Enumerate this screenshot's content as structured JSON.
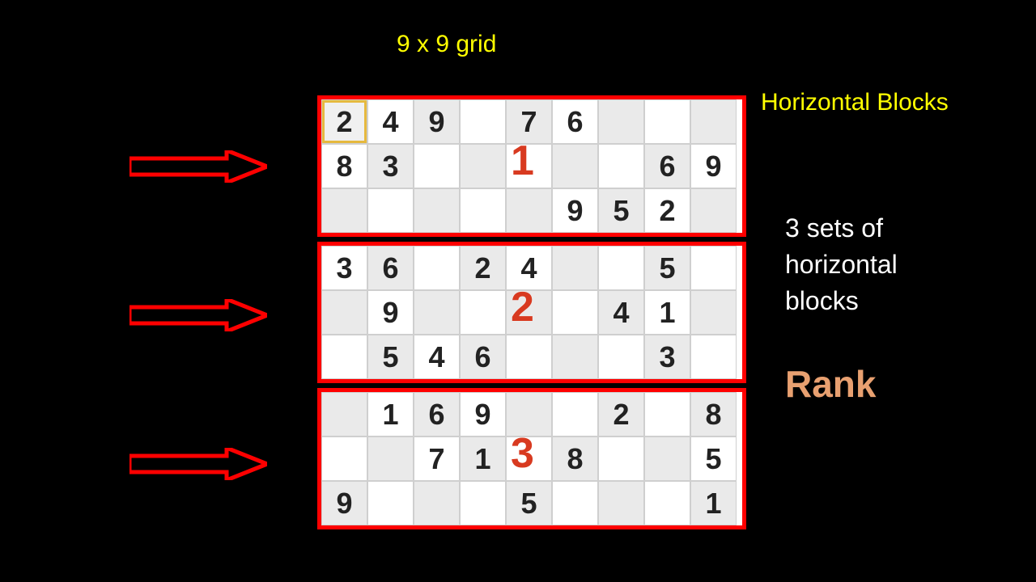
{
  "title": "9 x 9 grid",
  "labels": {
    "horizontalBlocks": "Horizontal Blocks",
    "setsLine1": "3 sets of",
    "setsLine2": "horizontal",
    "setsLine3": "blocks",
    "rank": "Rank"
  },
  "bandNumbers": [
    "1",
    "2",
    "3"
  ],
  "grid": [
    [
      "2",
      "4",
      "9",
      "",
      "7",
      "6",
      "",
      "",
      ""
    ],
    [
      "8",
      "3",
      "",
      "",
      "",
      "",
      "",
      "6",
      "9"
    ],
    [
      "",
      "",
      "",
      "",
      "",
      "9",
      "5",
      "2",
      ""
    ],
    [
      "3",
      "6",
      "",
      "2",
      "4",
      "",
      "",
      "5",
      ""
    ],
    [
      "",
      "9",
      "",
      "",
      "",
      "",
      "4",
      "1",
      ""
    ],
    [
      "",
      "5",
      "4",
      "6",
      "",
      "",
      "",
      "3",
      ""
    ],
    [
      "",
      "1",
      "6",
      "9",
      "",
      "",
      "2",
      "",
      "8"
    ],
    [
      "",
      "",
      "7",
      "1",
      "",
      "8",
      "",
      "",
      "5"
    ],
    [
      "9",
      "",
      "",
      "",
      "5",
      "",
      "",
      "",
      "1"
    ]
  ],
  "shadePattern": [
    [
      1,
      0,
      1,
      0,
      1,
      0,
      1,
      0,
      1
    ],
    [
      0,
      1,
      0,
      1,
      0,
      1,
      0,
      1,
      0
    ],
    [
      1,
      0,
      1,
      0,
      1,
      0,
      1,
      0,
      1
    ],
    [
      0,
      1,
      0,
      1,
      0,
      1,
      0,
      1,
      0
    ],
    [
      1,
      0,
      1,
      0,
      1,
      0,
      1,
      0,
      1
    ],
    [
      0,
      1,
      0,
      1,
      0,
      1,
      0,
      1,
      0
    ],
    [
      1,
      0,
      1,
      0,
      1,
      0,
      1,
      0,
      1
    ],
    [
      0,
      1,
      0,
      1,
      0,
      1,
      0,
      1,
      0
    ],
    [
      1,
      0,
      1,
      0,
      1,
      0,
      1,
      0,
      1
    ]
  ],
  "highlightCell": {
    "row": 0,
    "col": 0
  }
}
